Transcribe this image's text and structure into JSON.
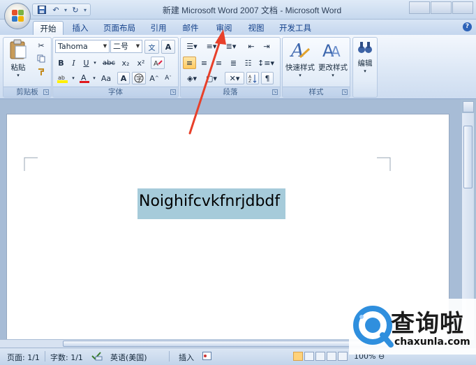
{
  "window": {
    "title": "新建 Microsoft Word 2007 文档 - Microsoft Word"
  },
  "quick_access": {
    "save_icon": "floppy-disk",
    "undo_icon": "undo-arrow",
    "redo_icon": "redo-arrow",
    "customize_icon": "dropdown-chevron"
  },
  "tabs": [
    {
      "label": "开始",
      "active": true
    },
    {
      "label": "插入"
    },
    {
      "label": "页面布局"
    },
    {
      "label": "引用"
    },
    {
      "label": "邮件"
    },
    {
      "label": "审阅"
    },
    {
      "label": "视图"
    },
    {
      "label": "开发工具"
    }
  ],
  "ribbon": {
    "clipboard": {
      "label": "剪贴板",
      "paste_label": "粘贴"
    },
    "font": {
      "label": "字体",
      "font_name": "Tahoma",
      "font_size": "二号",
      "bold": "B",
      "italic": "I",
      "underline": "U",
      "strikethrough": "abc",
      "subscript": "x₂",
      "superscript": "x²",
      "font_color_glyph": "A",
      "change_case": "Aa",
      "grow": "A",
      "shrink": "A",
      "char_border": "A",
      "pinyin": "文"
    },
    "paragraph": {
      "label": "段落"
    },
    "styles": {
      "label": "样式",
      "quick_styles": "快速样式",
      "change_styles": "更改样式"
    },
    "editing": {
      "label": "编辑"
    }
  },
  "document": {
    "selected_text": "Noighifcvkfnrjdbdf"
  },
  "statusbar": {
    "page": "页面: 1/1",
    "words": "字数: 1/1",
    "language": "英语(美国)",
    "insert_mode": "插入",
    "zoom": "100%"
  },
  "watermark": {
    "name": "查询啦",
    "url": "chaxunla.com"
  },
  "colors": {
    "accent": "#15428b",
    "arrow": "#e8402a",
    "selection": "#a6cbda"
  }
}
